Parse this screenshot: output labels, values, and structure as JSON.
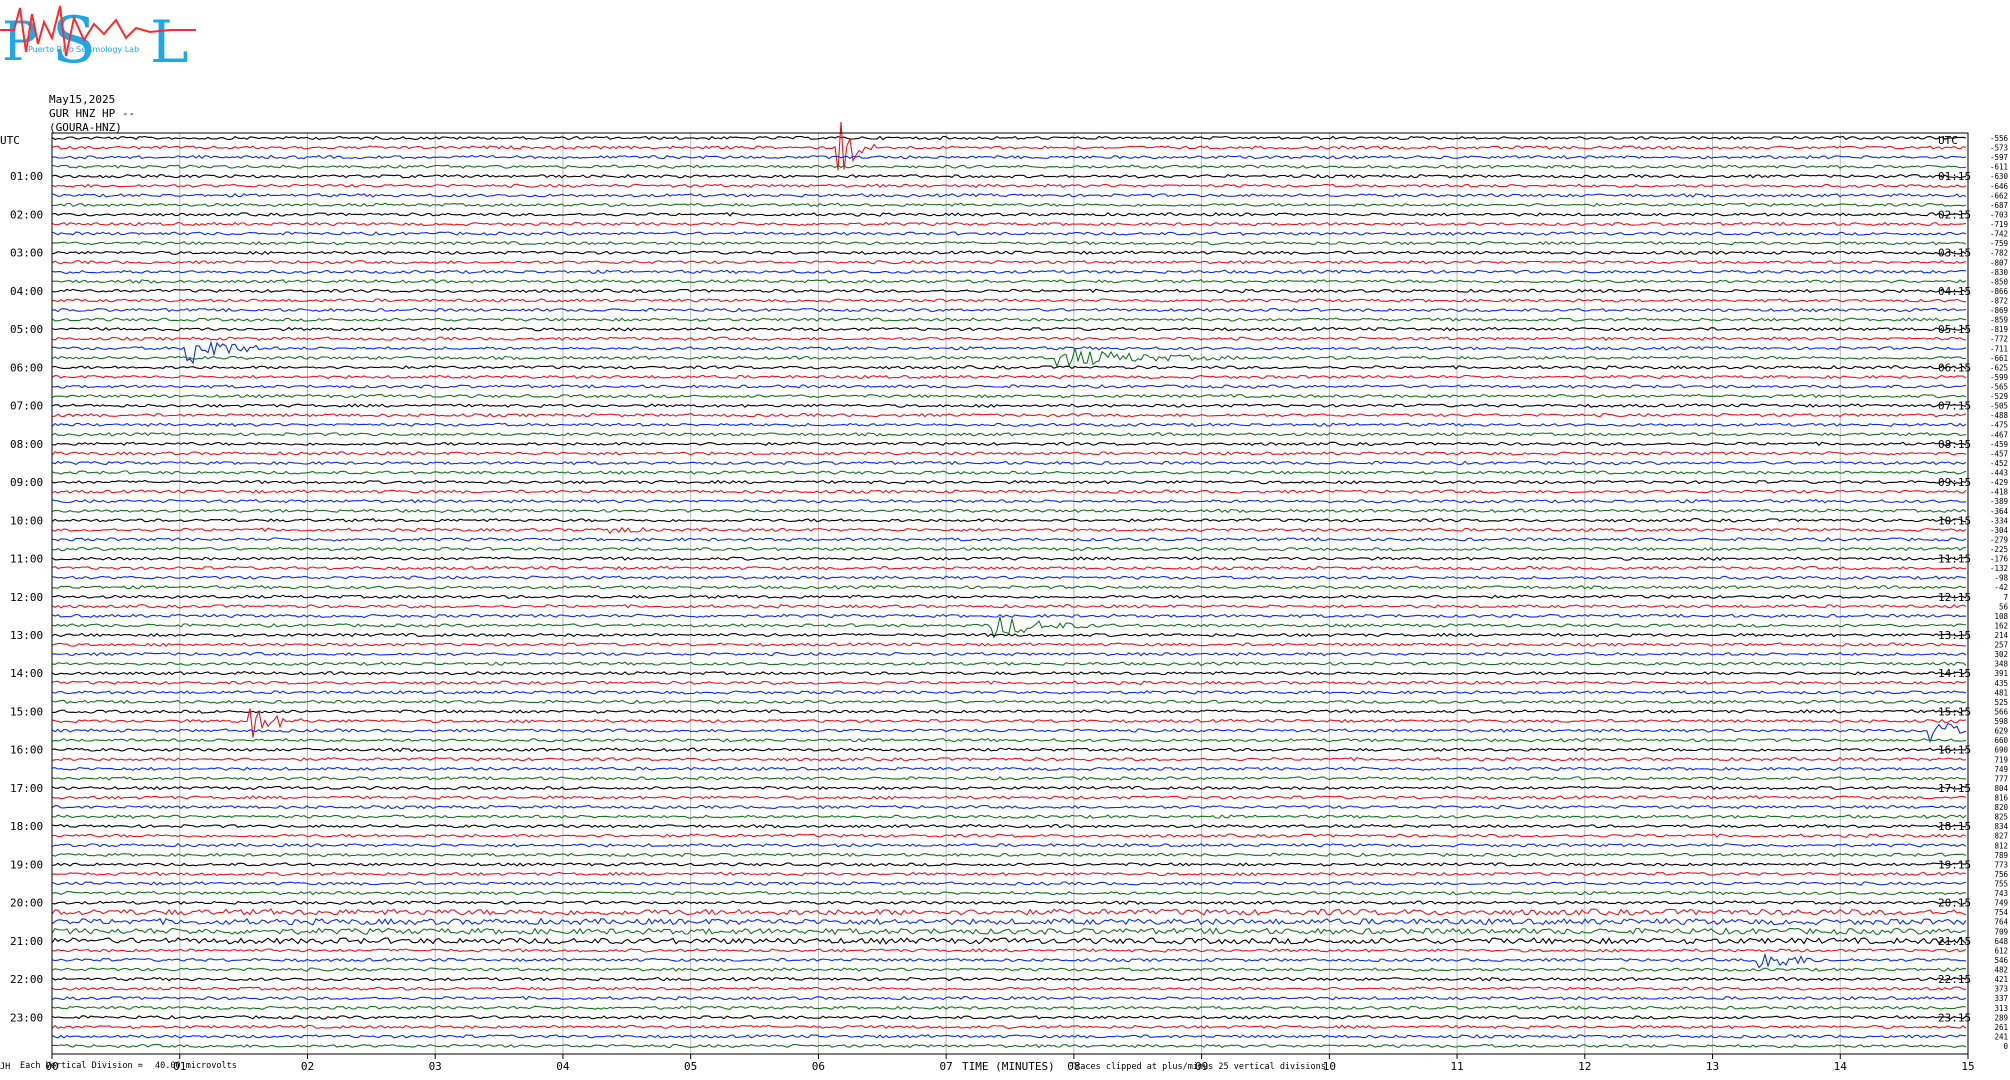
{
  "logo": {
    "letters": "PSL",
    "tagline": "Puerto Rico Seismology Lab",
    "colors": {
      "letters": "#1fa7e6",
      "wave": "#ff2a2a"
    }
  },
  "header": {
    "date": "May15,2025",
    "station": "GUR HNZ HP --",
    "channel": "(GOURA-HNZ)"
  },
  "left_axis_title": "UTC",
  "right_axis_title": "UTC",
  "footer": {
    "left_mark": "JH",
    "scale_label": "Each Vertical Division =",
    "scale_value": "40.00 microvolts",
    "x_title": "TIME (MINUTES)",
    "clip_note": "Traces clipped at plus/minus 25 vertical divisions"
  },
  "chart_data": {
    "type": "line",
    "title": "",
    "xlabel": "TIME (MINUTES)",
    "ylabel": "UTC",
    "x_ticks": [
      "00",
      "01",
      "02",
      "03",
      "04",
      "05",
      "06",
      "07",
      "08",
      "09",
      "10",
      "11",
      "12",
      "13",
      "14",
      "15"
    ],
    "xlim": [
      0,
      15
    ],
    "left_hour_labels": [
      "01:00",
      "02:00",
      "03:00",
      "04:00",
      "05:00",
      "06:00",
      "07:00",
      "08:00",
      "09:00",
      "10:00",
      "11:00",
      "12:00",
      "13:00",
      "14:00",
      "15:00",
      "16:00",
      "17:00",
      "18:00",
      "19:00",
      "20:00",
      "21:00",
      "22:00",
      "23:00"
    ],
    "right_hour_labels": [
      "01:15",
      "02:15",
      "03:15",
      "04:15",
      "05:15",
      "06:15",
      "07:15",
      "08:15",
      "09:15",
      "10:15",
      "11:15",
      "12:15",
      "13:15",
      "14:15",
      "15:15",
      "16:15",
      "17:15",
      "18:15",
      "19:15",
      "20:15",
      "21:15",
      "22:15",
      "23:15"
    ],
    "trace_colors": [
      "#000000",
      "#e8141c",
      "#0b2de8",
      "#16741e"
    ],
    "trace_count": 96,
    "minutes_per_trace": 15,
    "right_values": [
      -556,
      -573,
      -597,
      -611,
      -630,
      -646,
      -662,
      -687,
      -703,
      -719,
      -742,
      -759,
      -782,
      -807,
      -830,
      -850,
      -866,
      -872,
      -869,
      -859,
      -819,
      -772,
      -711,
      -661,
      -625,
      -599,
      -565,
      -529,
      -505,
      -488,
      -475,
      -467,
      -459,
      -457,
      -452,
      -443,
      -429,
      -418,
      -389,
      -364,
      -334,
      -304,
      -279,
      -225,
      -176,
      -132,
      -98,
      -42,
      7,
      56,
      108,
      162,
      214,
      257,
      302,
      348,
      391,
      435,
      481,
      525,
      566,
      598,
      629,
      660,
      690,
      719,
      749,
      777,
      804,
      816,
      820,
      825,
      834,
      827,
      812,
      789,
      773,
      756,
      755,
      743,
      749,
      754,
      764,
      709,
      648,
      612,
      546,
      482,
      421,
      373,
      337,
      313,
      289,
      261,
      241,
      0
    ],
    "events": [
      {
        "trace": 22,
        "minute": 1.1,
        "amp": 18,
        "dur": 0.6
      },
      {
        "trace": 1,
        "minute": 6.2,
        "amp": 30,
        "dur": 0.25
      },
      {
        "trace": 23,
        "minute": 7.9,
        "amp": 10,
        "dur": 1.4
      },
      {
        "trace": 41,
        "minute": 4.4,
        "amp": 7,
        "dur": 0.25
      },
      {
        "trace": 51,
        "minute": 7.4,
        "amp": 12,
        "dur": 0.8
      },
      {
        "trace": 61,
        "minute": 1.6,
        "amp": 16,
        "dur": 0.4
      },
      {
        "trace": 62,
        "minute": 14.75,
        "amp": 16,
        "dur": 0.3
      },
      {
        "trace": 86,
        "minute": 13.4,
        "amp": 14,
        "dur": 0.5
      }
    ]
  }
}
